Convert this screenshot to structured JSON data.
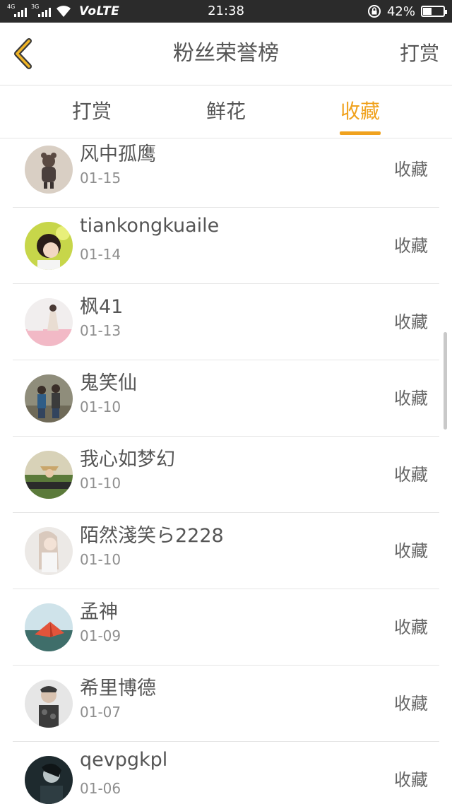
{
  "status_bar": {
    "network_1": "4G",
    "network_2": "3G",
    "carrier_label": "VoLTE",
    "time": "21:38",
    "battery_percent": "42%",
    "battery_level": 0.42
  },
  "header": {
    "title": "粉丝荣誉榜",
    "action_label": "打赏",
    "back_icon": "chevron-left-icon",
    "accent_color": "#f0a21e"
  },
  "tabs": [
    {
      "label": "打赏",
      "active": false
    },
    {
      "label": "鲜花",
      "active": false
    },
    {
      "label": "收藏",
      "active": true
    }
  ],
  "fans": [
    {
      "name": "风中孤鹰",
      "date": "01-15",
      "action": "收藏"
    },
    {
      "name": "tiankongkuaile",
      "date": "01-14",
      "action": "收藏"
    },
    {
      "name": "枫41",
      "date": "01-13",
      "action": "收藏"
    },
    {
      "name": "鬼笑仙",
      "date": "01-10",
      "action": "收藏"
    },
    {
      "name": "我心如梦幻",
      "date": "01-10",
      "action": "收藏"
    },
    {
      "name": "陌然淺笑ら2228",
      "date": "01-10",
      "action": "收藏"
    },
    {
      "name": "孟神",
      "date": "01-09",
      "action": "收藏"
    },
    {
      "name": "希里博德",
      "date": "01-07",
      "action": "收藏"
    },
    {
      "name": "qevpgkpl",
      "date": "01-06",
      "action": "收藏"
    }
  ]
}
